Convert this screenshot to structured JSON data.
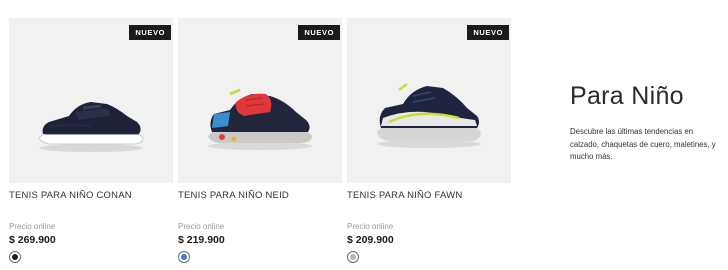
{
  "products": [
    {
      "badge": "NUEVO",
      "title": "TENIS PARA NIÑO CONAN",
      "price_label": "Precio online",
      "price": "$ 269.900",
      "swatch_color": "#1b1b2a",
      "icon": "navy-sneaker-image"
    },
    {
      "badge": "NUEVO",
      "title": "TENIS PARA NIÑO NEID",
      "price_label": "Precio online",
      "price": "$ 219.900",
      "swatch_color": "#3d7fc4",
      "icon": "red-blue-sneaker-image"
    },
    {
      "badge": "NUEVO",
      "title": "TENIS PARA NIÑO FAWN",
      "price_label": "Precio online",
      "price": "$ 209.900",
      "swatch_color": "#b5b5b5",
      "icon": "navy-lime-sneaker-image"
    }
  ],
  "promo": {
    "title": "Para Niño",
    "text": "Descubre las últimas tendencias en calzado, chaquetas de cuero, maletines, y mucho más."
  }
}
